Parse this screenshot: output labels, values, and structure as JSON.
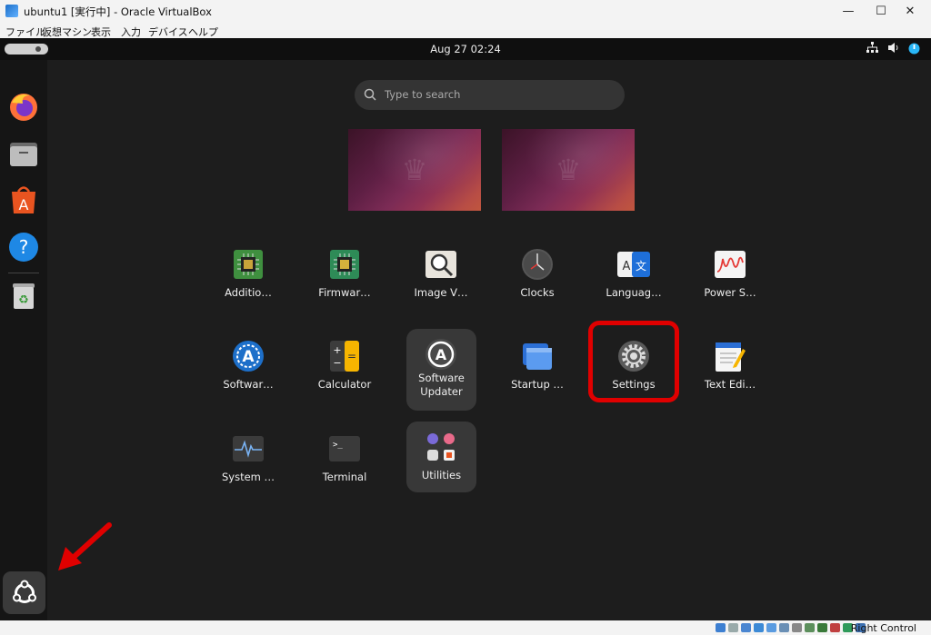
{
  "host": {
    "title": "ubuntu1 [実行中] - Oracle VirtualBox",
    "menu": [
      "ファイル",
      "仮想マシン",
      "表示",
      "入力",
      "デバイス",
      "ヘルプ"
    ],
    "controls": {
      "minimize": "—",
      "maximize": "☐",
      "close": "✕"
    },
    "statusbar": {
      "host_key": "Right Control"
    }
  },
  "guest": {
    "clock": "Aug 27  02:24",
    "search_placeholder": "Type to search",
    "dock": [
      "firefox",
      "files",
      "app-center",
      "help",
      "trash"
    ],
    "apps": [
      {
        "label": "Additio…",
        "icon": "chip-icon"
      },
      {
        "label": "Firmwar…",
        "icon": "chip-icon"
      },
      {
        "label": "Image V…",
        "icon": "image-viewer-icon"
      },
      {
        "label": "Clocks",
        "icon": "clock-icon"
      },
      {
        "label": "Languag…",
        "icon": "language-icon"
      },
      {
        "label": "Power S…",
        "icon": "power-stats-icon"
      },
      {
        "label": "Softwar…",
        "icon": "software-icon"
      },
      {
        "label": "Calculator",
        "icon": "calculator-icon"
      },
      {
        "label": "Software Updater",
        "icon": "updater-icon"
      },
      {
        "label": "Startup …",
        "icon": "startup-icon"
      },
      {
        "label": "Settings",
        "icon": "settings-icon"
      },
      {
        "label": "Text Edi…",
        "icon": "text-editor-icon"
      },
      {
        "label": "System …",
        "icon": "system-monitor-icon"
      },
      {
        "label": "Terminal",
        "icon": "terminal-icon"
      },
      {
        "label": "Utilities",
        "icon": "utilities-folder-icon"
      }
    ]
  },
  "colors": {
    "highlight": "#e00000",
    "accent": "#e95420"
  }
}
